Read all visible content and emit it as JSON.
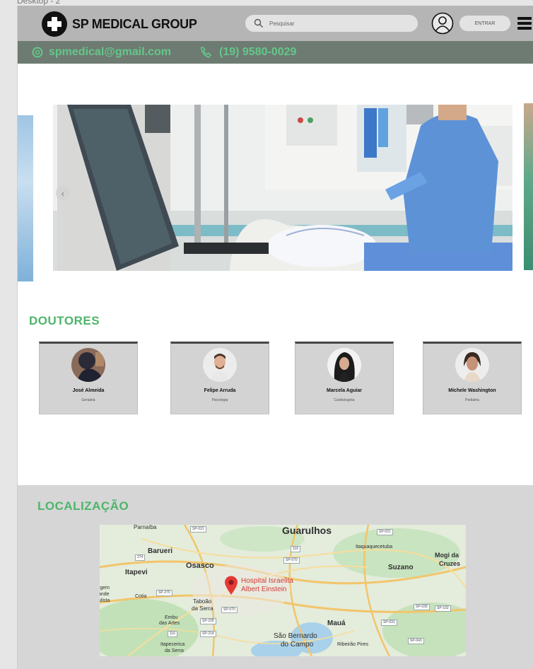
{
  "frame_label": "Desktop - 2",
  "header": {
    "brand": "SP MEDICAL GROUP",
    "search_placeholder": "Pesquisar",
    "enter_button": "ENTRAR"
  },
  "contact": {
    "email": "spmedical@gmail.com",
    "phone": "(19) 9580-0029"
  },
  "colors": {
    "accent_green": "#4db56a",
    "header_gray": "#b5b5b5",
    "contact_bar": "#6e7b72"
  },
  "doctors": {
    "title": "DOUTORES",
    "items": [
      {
        "name": "José Almeida",
        "specialty": "Geriatria"
      },
      {
        "name": "Felipe Arruda",
        "specialty": "Psicologia"
      },
      {
        "name": "Marcela Aguiar",
        "specialty": "Cardiologista"
      },
      {
        "name": "Michele Washington",
        "specialty": "Pediatria"
      }
    ]
  },
  "location": {
    "title": "LOCALIZAÇÃO",
    "map": {
      "pin_label_line1": "Hospital Israelita",
      "pin_label_line2": "Albert Einstein",
      "cities": {
        "guarulhos": "Guarulhos",
        "barueri": "Barueri",
        "osasco": "Osasco",
        "itapevi": "Itapevi",
        "suzano": "Suzano",
        "mogi1": "Mogi da",
        "mogi2": "Cruzes",
        "parnaiba": "Parnaíba",
        "itaquaquecetuba": "Itaquaquecetuba",
        "taboao1": "Taboão",
        "taboao2": "da Serra",
        "embu1": "Embu",
        "embu2": "das Artes",
        "cotia": "Cotia",
        "maua": "Mauá",
        "sbc1": "São Bernardo",
        "sbc2": "do Campo",
        "ribeirao": "Ribeirão Pires",
        "itapecerica1": "Itapecerica",
        "itapecerica2": "da Serra",
        "vargem1": "rgem",
        "vargem2": "ande",
        "vargem3": "ulista"
      }
    }
  }
}
